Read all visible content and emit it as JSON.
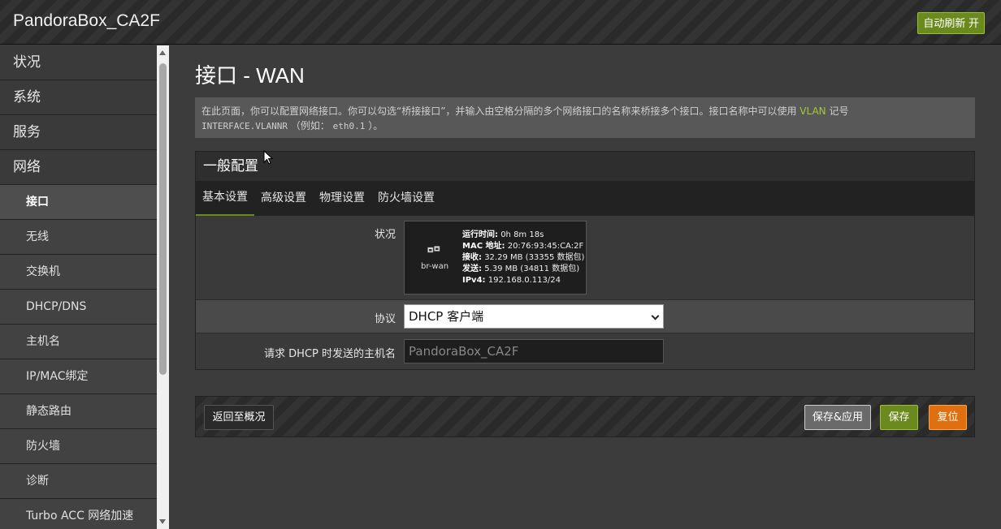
{
  "header": {
    "brand": "PandoraBox_CA2F",
    "refresh_button": "自动刷新 开"
  },
  "sidebar": {
    "items": [
      {
        "label": "状况",
        "level": 1
      },
      {
        "label": "系统",
        "level": 1
      },
      {
        "label": "服务",
        "level": 1
      },
      {
        "label": "网络",
        "level": 1
      },
      {
        "label": "接口",
        "level": 2,
        "active": true
      },
      {
        "label": "无线",
        "level": 2
      },
      {
        "label": "交换机",
        "level": 2
      },
      {
        "label": "DHCP/DNS",
        "level": 2
      },
      {
        "label": "主机名",
        "level": 2
      },
      {
        "label": "IP/MAC绑定",
        "level": 2
      },
      {
        "label": "静态路由",
        "level": 2
      },
      {
        "label": "防火墙",
        "level": 2
      },
      {
        "label": "诊断",
        "level": 2
      },
      {
        "label": "Turbo ACC 网络加速",
        "level": 2
      }
    ]
  },
  "main": {
    "title": "接口 - WAN",
    "description": {
      "part1": "在此页面，你可以配置网络接口。你可以勾选“桥接接口”，并输入由空格分隔的多个网络接口的名称来桥接多个接口。接口名称中可以使用",
      "vlan": "VLAN",
      "part2": "记号",
      "code": "INTERFACE.VLANNR",
      "part3": "（例如：",
      "example": "eth0.1",
      "part4": "）。"
    },
    "section_title": "一般配置",
    "tabs": [
      {
        "label": "基本设置",
        "active": true
      },
      {
        "label": "高级设置"
      },
      {
        "label": "物理设置"
      },
      {
        "label": "防火墙设置"
      }
    ],
    "status": {
      "label": "状况",
      "iface_name": "br-wan",
      "uptime_label": "运行时间:",
      "uptime": "0h 8m 18s",
      "mac_label": "MAC 地址:",
      "mac": "20:76:93:45:CA:2F",
      "rx_label": "接收:",
      "rx": "32.29 MB (33355 数据包)",
      "tx_label": "发送:",
      "tx": "5.39 MB (34811 数据包)",
      "ipv4_label": "IPv4:",
      "ipv4": "192.168.0.113/24"
    },
    "protocol": {
      "label": "协议",
      "value": "DHCP 客户端"
    },
    "hostname": {
      "label": "请求 DHCP 时发送的主机名",
      "placeholder": "PandoraBox_CA2F"
    }
  },
  "actions": {
    "back": "返回至概况",
    "save_apply": "保存&应用",
    "save": "保存",
    "reset": "复位"
  }
}
